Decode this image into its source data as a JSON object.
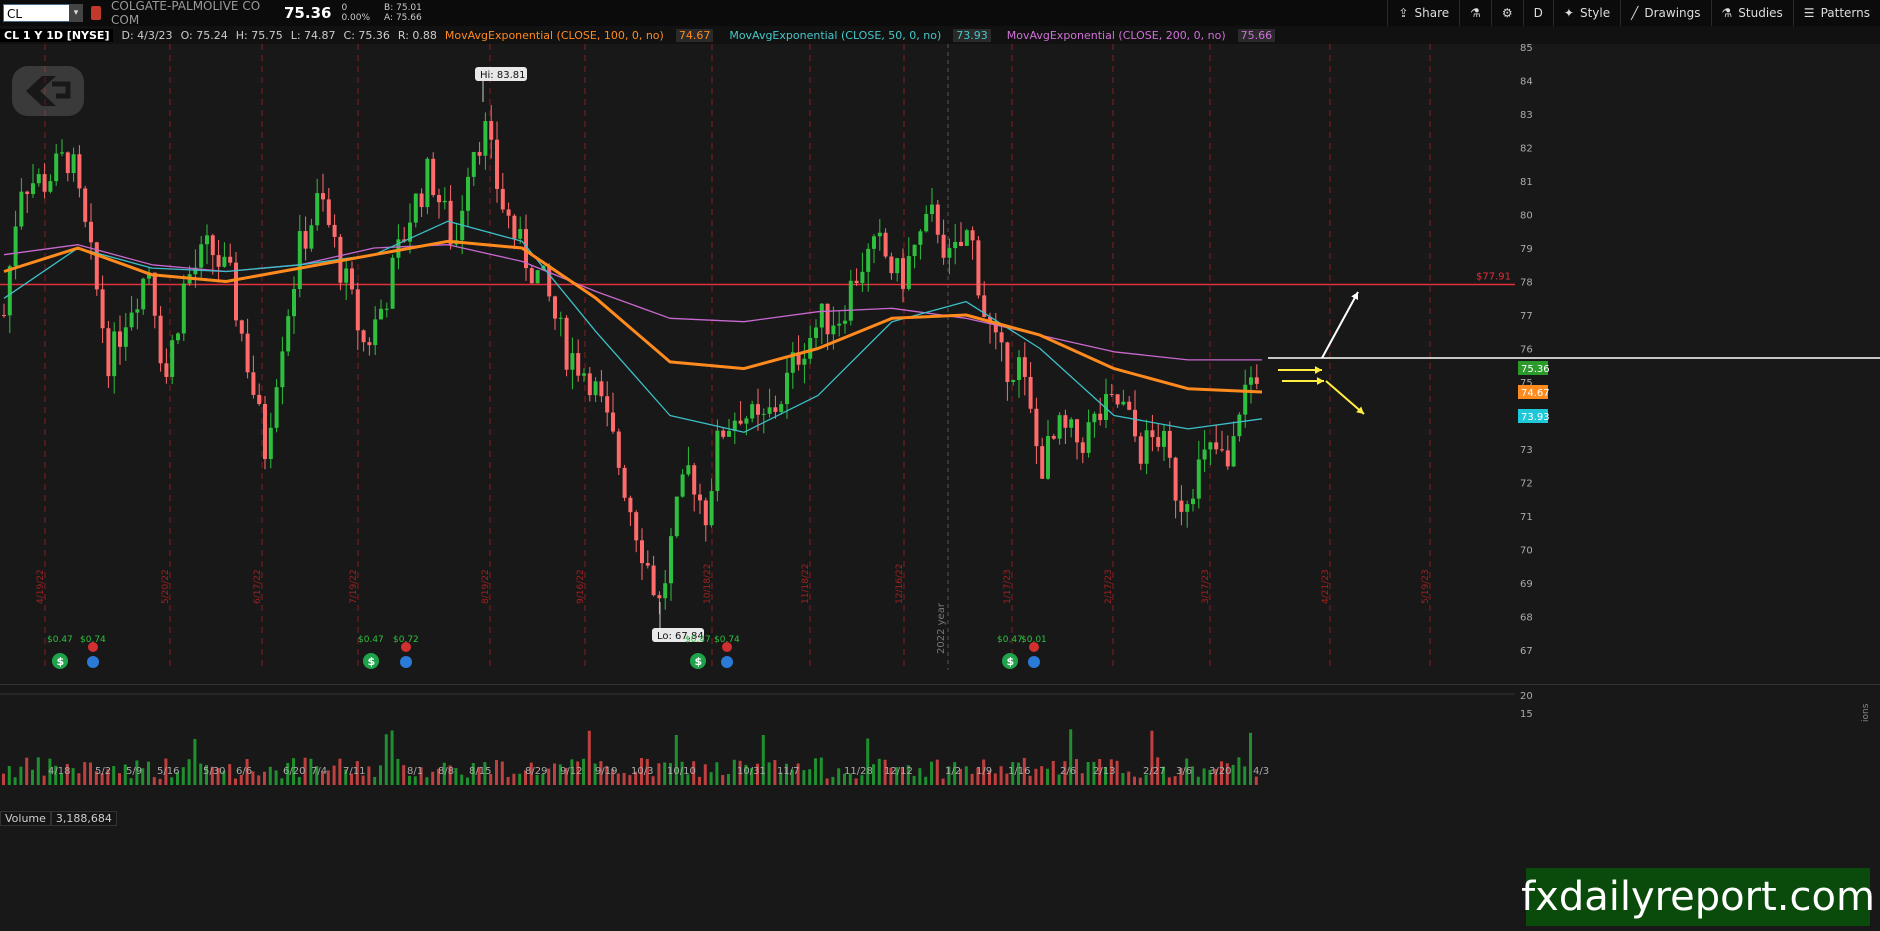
{
  "toolbar": {
    "symbol": "CL",
    "company": "COLGATE-PALMOLIVE CO COM",
    "last": "75.36",
    "change": "0",
    "change_pct": "0.00%",
    "bid": "B: 75.01",
    "ask": "A: 75.66",
    "share": "Share",
    "timeframe": "D",
    "style": "Style",
    "drawings": "Drawings",
    "studies": "Studies",
    "patterns": "Patterns"
  },
  "info": {
    "tag": "CL 1 Y 1D [NYSE]",
    "date": "D: 4/3/23",
    "open": "O: 75.24",
    "high": "H: 75.75",
    "low": "L: 74.87",
    "close": "C: 75.36",
    "range": "R: 0.88",
    "ma100_label": "MovAvgExponential (CLOSE, 100, 0, no)",
    "ma100_value": "74.67",
    "ma50_label": "MovAvgExponential (CLOSE, 50, 0, no)",
    "ma50_value": "73.93",
    "ma200_label": "MovAvgExponential (CLOSE, 200, 0, no)",
    "ma200_value": "75.66"
  },
  "volume": {
    "label": "Volume",
    "value": "3,188,684"
  },
  "watermark": "fxdailyreport.com",
  "chart_data": {
    "type": "candlestick",
    "y_ticks": [
      67,
      68,
      69,
      70,
      71,
      72,
      73,
      74,
      75,
      76,
      77,
      78,
      79,
      80,
      81,
      82,
      83,
      84,
      85
    ],
    "ylim": [
      66.5,
      85.4
    ],
    "volume_ticks": [
      "15",
      "20"
    ],
    "volume_axis_label": "ions",
    "x_ticks": [
      "4/18",
      "5/2",
      "5/9",
      "5/16",
      "5/30",
      "6/6",
      "6/20",
      "7/4",
      "7/11",
      "8/1",
      "8/8",
      "8/15",
      "8/29",
      "9/12",
      "9/19",
      "10/3",
      "10/10",
      "10/31",
      "11/7",
      "11/28",
      "12/12",
      "1/2",
      "1/9",
      "1/16",
      "2/6",
      "2/13",
      "2/27",
      "3/6",
      "3/20",
      "4/3"
    ],
    "year_marker": "2022 year",
    "resistance_level": 77.91,
    "resistance_label": "$77.91",
    "hi_label": "Hi: 83.81",
    "lo_label": "Lo: 67.84",
    "price_tags": [
      {
        "value": "75.36",
        "color": "#2a9a2a"
      },
      {
        "value": "74.67",
        "color": "#ff8a1e"
      },
      {
        "value": "73.93",
        "color": "#1fc8d8"
      }
    ],
    "dividends": [
      "$0.47",
      "$0.74",
      "$0.47",
      "$0.72",
      "$0.47",
      "$0.74",
      "$0.47",
      "$0.01"
    ],
    "vertical_markers": [
      "4/19/22",
      "5/20/22",
      "6/17/22",
      "7/19/22",
      "8/19/22",
      "9/16/22",
      "10/18/22",
      "11/18/22",
      "12/16/22",
      "1/17/23",
      "2/17/23",
      "3/17/23",
      "4/21/23",
      "5/19/23"
    ],
    "ema50": [
      77.5,
      79.0,
      78.4,
      78.3,
      78.5,
      78.8,
      79.8,
      79.2,
      76.5,
      74.0,
      73.5,
      74.6,
      76.8,
      77.4,
      76.0,
      74.0,
      73.6,
      73.9
    ],
    "ema100": [
      78.3,
      79.0,
      78.2,
      78.0,
      78.4,
      78.8,
      79.2,
      79.0,
      77.5,
      75.6,
      75.4,
      76.0,
      76.9,
      77.0,
      76.4,
      75.4,
      74.8,
      74.7
    ],
    "ema200": [
      78.8,
      79.1,
      78.5,
      78.3,
      78.5,
      79.0,
      79.1,
      78.6,
      77.7,
      76.9,
      76.8,
      77.1,
      77.2,
      76.9,
      76.4,
      75.9,
      75.66,
      75.66
    ]
  }
}
